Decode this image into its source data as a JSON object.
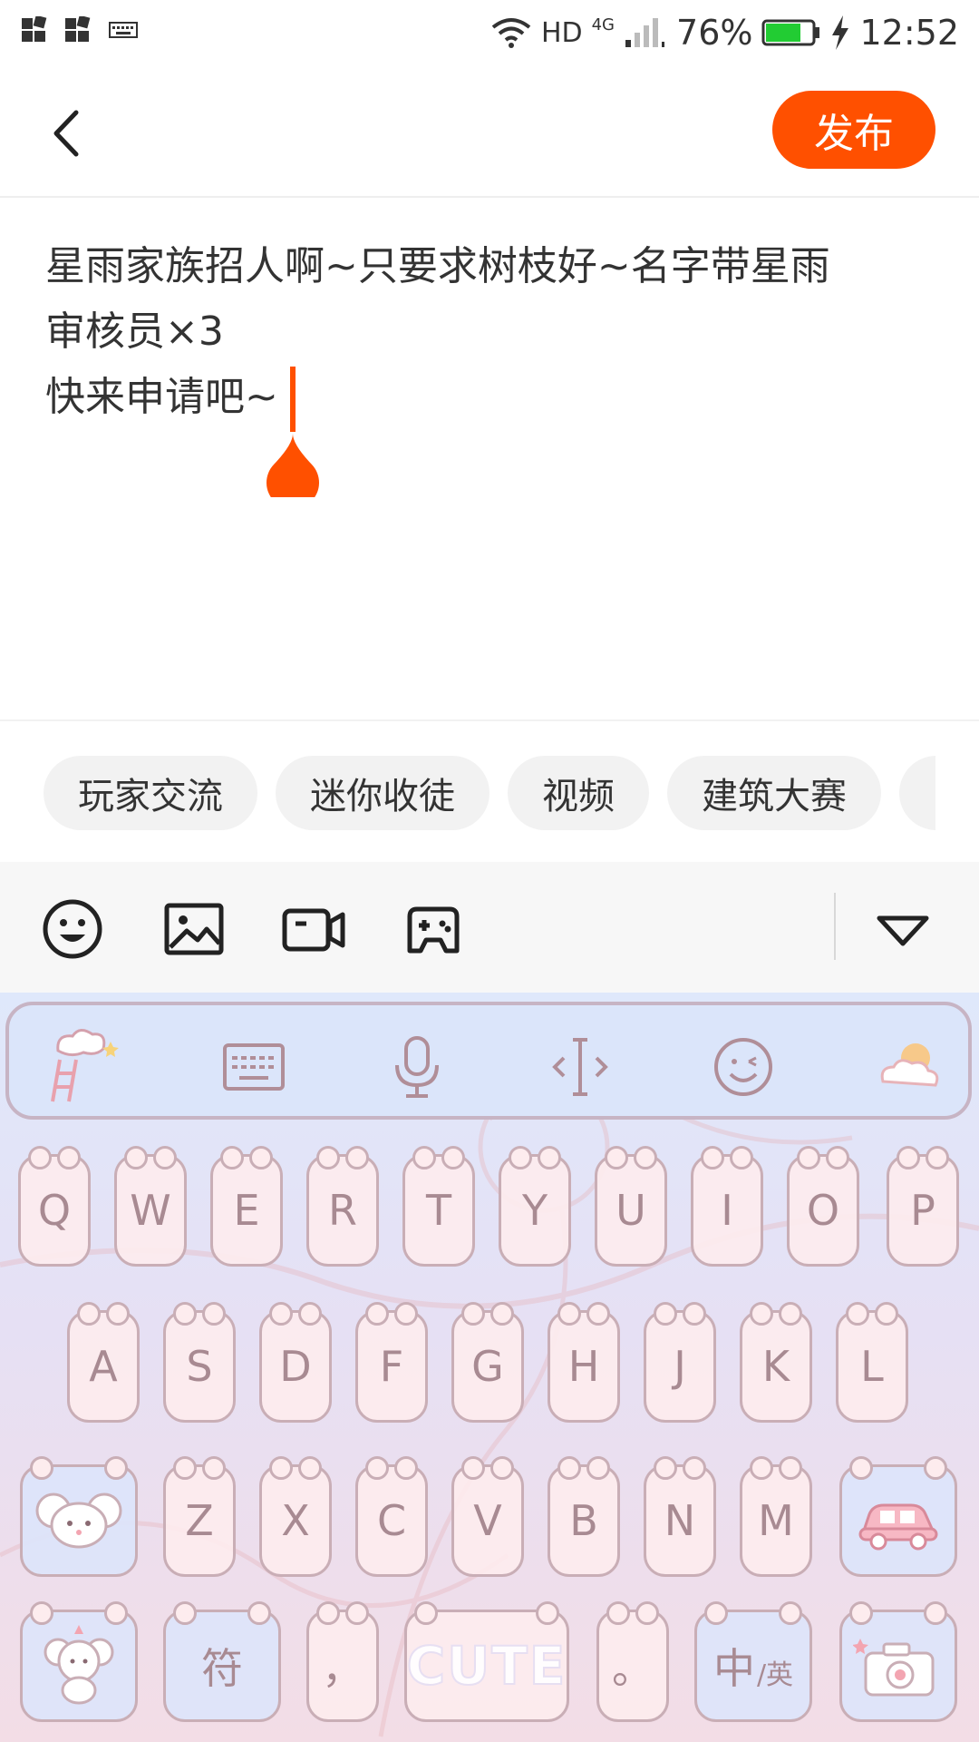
{
  "status_bar": {
    "network_label": "HD",
    "network_type": "4G",
    "battery_percent": "76%",
    "time": "12:52",
    "battery_level": 0.76
  },
  "header": {
    "publish_label": "发布"
  },
  "editor": {
    "lines": [
      "星雨家族招人啊~只要求树枝好~名字带星雨",
      "审核员×3",
      "快来申请吧~"
    ]
  },
  "tags": [
    "玩家交流",
    "迷你收徒",
    "视频",
    "建筑大赛"
  ],
  "toolbar": {
    "icons": [
      "emoji-icon",
      "image-icon",
      "video-icon",
      "game-icon",
      "collapse-icon"
    ]
  },
  "keyboard": {
    "row1": [
      "Q",
      "W",
      "E",
      "R",
      "T",
      "Y",
      "U",
      "I",
      "O",
      "P"
    ],
    "row2": [
      "A",
      "S",
      "D",
      "F",
      "G",
      "H",
      "J",
      "K",
      "L"
    ],
    "row3": [
      "Z",
      "X",
      "C",
      "V",
      "B",
      "N",
      "M"
    ],
    "symbol_key": "符",
    "comma_key": "，",
    "space_label": "CUTE",
    "period_key": "。",
    "lang_key_main": "中",
    "lang_key_sub": "/英",
    "colors": {
      "accent": "#ff5000",
      "key_bg": "#fdecee",
      "key_text": "#a88a92",
      "key_border": "#c9aeb6"
    }
  }
}
